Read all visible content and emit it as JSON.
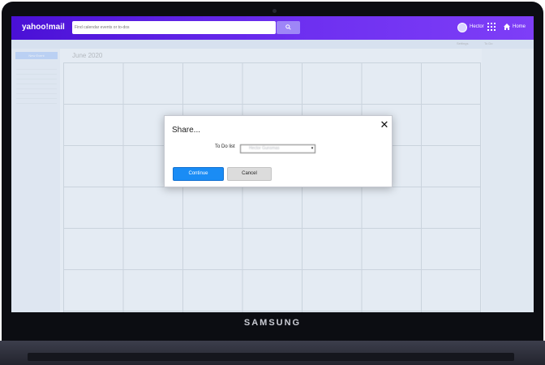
{
  "device": {
    "brand": "SAMSUNG"
  },
  "app": {
    "logo": "yahoo!mail",
    "search_placeholder": "Find calendar events or to-dos",
    "user_name": "Hector",
    "home_label": "Home"
  },
  "calendar": {
    "month_title": "June 2020",
    "settings_label": "Settings",
    "todo_label": "To Do",
    "new_event_label": "New Event"
  },
  "dialog": {
    "title": "Share...",
    "share_label": "To Do list",
    "selected_value": "Hector Gunsmas",
    "continue_label": "Continue",
    "cancel_label": "Cancel",
    "close_symbol": "✕"
  },
  "colors": {
    "topbar_start": "#4a10d6",
    "topbar_end": "#7e3ef7",
    "primary_button": "#1a8cf5",
    "secondary_button": "#dcdcdc"
  },
  "icons": [
    "search-icon",
    "apps-grid-icon",
    "home-icon",
    "close-icon",
    "dropdown-arrow-icon",
    "avatar"
  ]
}
